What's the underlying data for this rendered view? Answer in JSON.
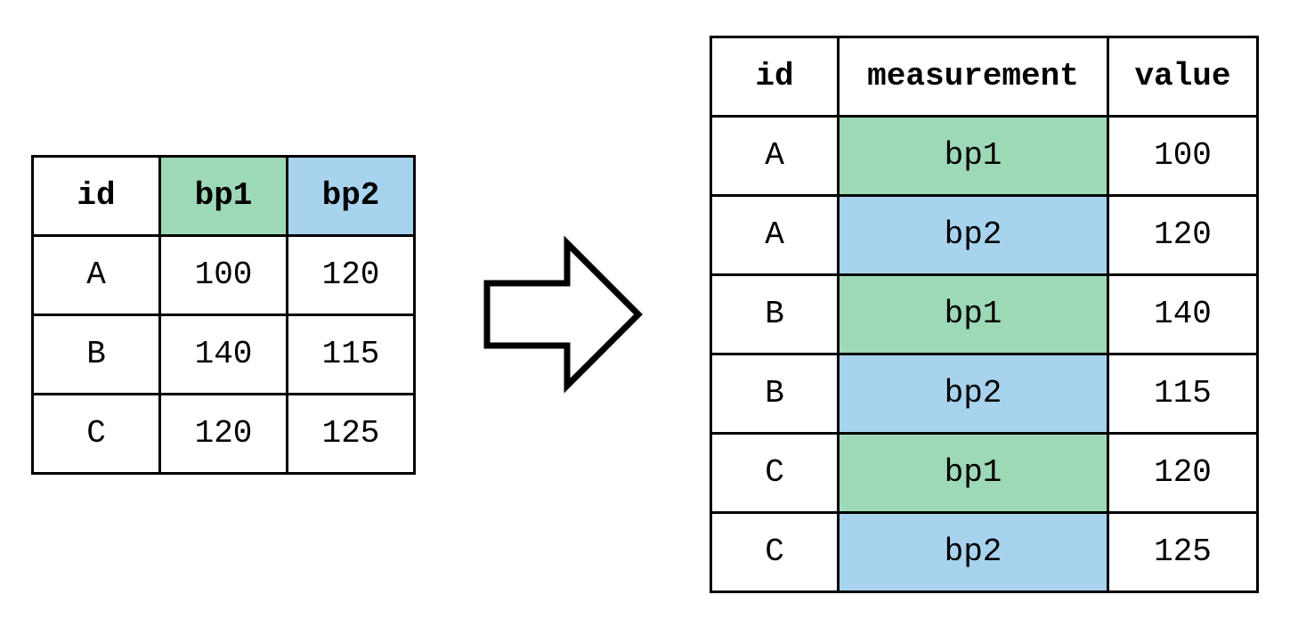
{
  "colors": {
    "green": "#9dd9b6",
    "blue": "#a8d3ee",
    "border": "#000000",
    "bg": "#ffffff"
  },
  "left_table": {
    "headers": {
      "id": "id",
      "bp1": "bp1",
      "bp2": "bp2"
    },
    "rows": [
      {
        "id": "A",
        "bp1": "100",
        "bp2": "120"
      },
      {
        "id": "B",
        "bp1": "140",
        "bp2": "115"
      },
      {
        "id": "C",
        "bp1": "120",
        "bp2": "125"
      }
    ]
  },
  "right_table": {
    "headers": {
      "id": "id",
      "measurement": "measurement",
      "value": "value"
    },
    "rows": [
      {
        "id": "A",
        "measurement": "bp1",
        "value": "100",
        "color": "green"
      },
      {
        "id": "A",
        "measurement": "bp2",
        "value": "120",
        "color": "blue"
      },
      {
        "id": "B",
        "measurement": "bp1",
        "value": "140",
        "color": "green"
      },
      {
        "id": "B",
        "measurement": "bp2",
        "value": "115",
        "color": "blue"
      },
      {
        "id": "C",
        "measurement": "bp1",
        "value": "120",
        "color": "green"
      },
      {
        "id": "C",
        "measurement": "bp2",
        "value": "125",
        "color": "blue"
      }
    ]
  },
  "chart_data": {
    "type": "table",
    "description": "Wide-to-long table reshape (pivot_longer / melt). Wide columns bp1, bp2 become values of a 'measurement' column.",
    "wide": {
      "columns": [
        "id",
        "bp1",
        "bp2"
      ],
      "rows": [
        {
          "id": "A",
          "bp1": 100,
          "bp2": 120
        },
        {
          "id": "B",
          "bp1": 140,
          "bp2": 115
        },
        {
          "id": "C",
          "bp1": 120,
          "bp2": 125
        }
      ]
    },
    "long": {
      "columns": [
        "id",
        "measurement",
        "value"
      ],
      "rows": [
        {
          "id": "A",
          "measurement": "bp1",
          "value": 100
        },
        {
          "id": "A",
          "measurement": "bp2",
          "value": 120
        },
        {
          "id": "B",
          "measurement": "bp1",
          "value": 140
        },
        {
          "id": "B",
          "measurement": "bp2",
          "value": 115
        },
        {
          "id": "C",
          "measurement": "bp1",
          "value": 120
        },
        {
          "id": "C",
          "measurement": "bp2",
          "value": 125
        }
      ]
    },
    "color_legend": {
      "bp1": "green",
      "bp2": "blue"
    }
  }
}
